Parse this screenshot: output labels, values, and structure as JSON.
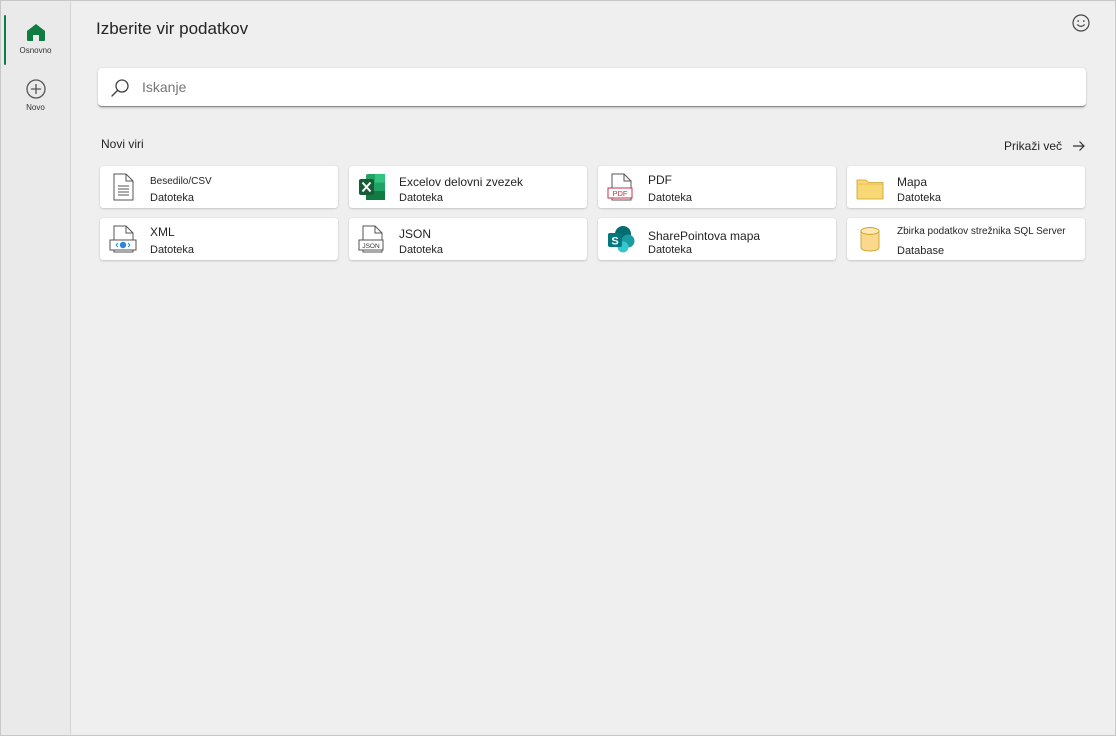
{
  "rail": {
    "items": [
      {
        "label": "Osnovno",
        "icon": "home-icon",
        "active": true
      },
      {
        "label": "Novo",
        "icon": "add-circle-icon",
        "active": false
      }
    ]
  },
  "header": {
    "title": "Izberite vir podatkov",
    "feedback_icon": "smiley-icon"
  },
  "search": {
    "placeholder": "Iskanje"
  },
  "section": {
    "title": "Novi viri",
    "show_more": "Prikaži več"
  },
  "sources": [
    {
      "name": "Besedilo/CSV",
      "type": "Datoteka",
      "icon": "text-file-icon"
    },
    {
      "name": "Excelov delovni zvezek",
      "type": "Datoteka",
      "icon": "excel-icon"
    },
    {
      "name": "PDF",
      "type": "Datoteka",
      "icon": "pdf-file-icon"
    },
    {
      "name": "Mapa",
      "type": "Datoteka",
      "icon": "folder-icon"
    },
    {
      "name": "XML",
      "type": "Datoteka",
      "icon": "xml-file-icon"
    },
    {
      "name": "JSON",
      "type": "Datoteka",
      "icon": "json-file-icon"
    },
    {
      "name": "SharePointova mapa",
      "type": "Datoteka",
      "icon": "sharepoint-icon"
    },
    {
      "name": "Zbirka podatkov strežnika SQL Server",
      "type": "Database",
      "icon": "database-icon"
    }
  ],
  "colors": {
    "accent": "#107c41",
    "excel_green": "#1d6f42",
    "sharepoint_teal": "#038387",
    "folder_yellow": "#f8d775",
    "pdf_red": "#c4314b"
  }
}
